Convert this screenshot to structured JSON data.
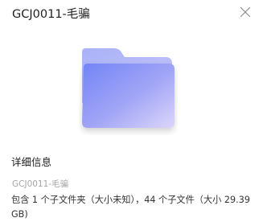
{
  "window": {
    "title": "GCJ0011-毛骗",
    "close_icon": "close-icon"
  },
  "preview": {
    "icon": "folder-icon",
    "colors": {
      "back": "#b6bcf6",
      "front_start": "#7a8bf7",
      "front_end": "#d7d2fa"
    }
  },
  "details": {
    "heading": "详细信息",
    "name": "GCJ0011-毛骗",
    "description": "包含 1 个子文件夹（大小未知），44 个子文件（大小 29.39 GB)"
  }
}
